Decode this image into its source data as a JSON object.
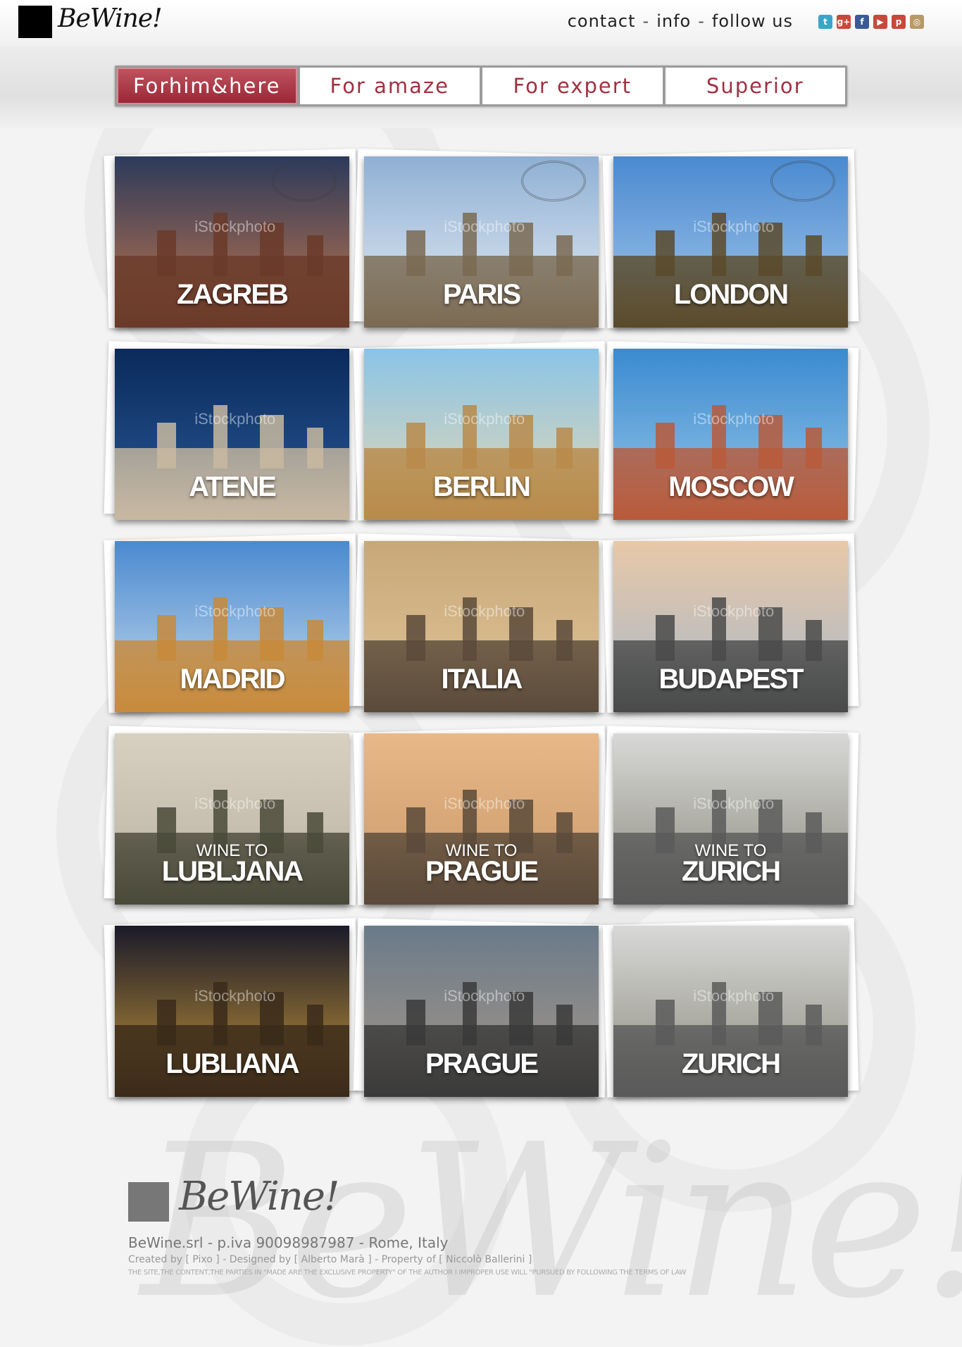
{
  "header": {
    "logo_text": "BeWine!",
    "nav": [
      {
        "label": "contact"
      },
      {
        "label": "info"
      },
      {
        "label": "follow us"
      }
    ],
    "separator": "-",
    "social": [
      {
        "name": "twitter-icon",
        "glyph": "t",
        "color": "#3aa5c8"
      },
      {
        "name": "google-plus-icon",
        "glyph": "g+",
        "color": "#c8493a"
      },
      {
        "name": "facebook-icon",
        "glyph": "f",
        "color": "#3a5a98"
      },
      {
        "name": "youtube-icon",
        "glyph": "▶",
        "color": "#c8493a"
      },
      {
        "name": "pinterest-icon",
        "glyph": "p",
        "color": "#c8493a"
      },
      {
        "name": "instagram-icon",
        "glyph": "◎",
        "color": "#b89a6a"
      }
    ]
  },
  "categories": [
    {
      "label": "Forhim&here",
      "active": true
    },
    {
      "label": "For amaze",
      "active": false
    },
    {
      "label": "For expert",
      "active": false
    },
    {
      "label": "Superior",
      "active": false
    }
  ],
  "cards": [
    {
      "city": "ZAGREB",
      "kicker": "",
      "sky": "#2c3a5c",
      "sky2": "#c6784a",
      "ground": "#6a3a2a",
      "stamp": true
    },
    {
      "city": "PARIS",
      "kicker": "",
      "sky": "#8fb0d4",
      "sky2": "#e8eef4",
      "ground": "#7a6a52",
      "stamp": true
    },
    {
      "city": "LONDON",
      "kicker": "",
      "sky": "#4a8ad0",
      "sky2": "#a6c8ea",
      "ground": "#5a4a2a",
      "stamp": true
    },
    {
      "city": "ATENE",
      "kicker": "",
      "sky": "#0a2a5a",
      "sky2": "#2a5a9a",
      "ground": "#c8b8a0",
      "stamp": false
    },
    {
      "city": "BERLIN",
      "kicker": "",
      "sky": "#8ac4e8",
      "sky2": "#e8d8b0",
      "ground": "#b88a4a",
      "stamp": false
    },
    {
      "city": "MOSCOW",
      "kicker": "",
      "sky": "#3a8ad0",
      "sky2": "#9ac8e8",
      "ground": "#b85a3a",
      "stamp": false
    },
    {
      "city": "MADRID",
      "kicker": "",
      "sky": "#4a8ad0",
      "sky2": "#c8dcec",
      "ground": "#c88a3a",
      "stamp": false
    },
    {
      "city": "ITALIA",
      "kicker": "",
      "sky": "#c8a878",
      "sky2": "#e0c49a",
      "ground": "#5a4a3a",
      "stamp": false
    },
    {
      "city": "BUDAPEST",
      "kicker": "",
      "sky": "#e8c8a8",
      "sky2": "#a8b8c8",
      "ground": "#4a4a4a",
      "stamp": false
    },
    {
      "city": "LUBLJANA",
      "kicker": "WINE TO",
      "sky": "#d8d0c0",
      "sky2": "#b8b0a0",
      "ground": "#4a4a3a",
      "stamp": false
    },
    {
      "city": "PRAGUE",
      "kicker": "WINE TO",
      "sky": "#e8b888",
      "sky2": "#c89868",
      "ground": "#5a4a3a",
      "stamp": false
    },
    {
      "city": "ZURICH",
      "kicker": "WINE TO",
      "sky": "#d8d8d8",
      "sky2": "#8a8a7a",
      "ground": "#5a5a5a",
      "stamp": false
    },
    {
      "city": "LUBLIANA",
      "kicker": "",
      "sky": "#1a1a2a",
      "sky2": "#c89838",
      "ground": "#3a2a1a",
      "stamp": false
    },
    {
      "city": "PRAGUE",
      "kicker": "",
      "sky": "#6a7a8a",
      "sky2": "#a89888",
      "ground": "#3a3a3a",
      "stamp": false
    },
    {
      "city": "ZURICH",
      "kicker": "",
      "sky": "#d8d8d8",
      "sky2": "#8a8a7a",
      "ground": "#5a5a5a",
      "stamp": false
    }
  ],
  "watermark": "iStockphoto",
  "footer": {
    "logo_text": "BeWine!",
    "company": "BeWine.srl - p.iva 90098987987 - Rome, Italy",
    "credits": "Created by [ Pixo ] - Designed by [ Alberto Marà ] - Property of [ Niccolò Ballerini ]",
    "legal": "THE SITE,THE CONTENT,THE PARTIES IN \"MADE ARE THE EXCLUSIVE PROPERTY\" OF THE AUTHOR I IMPROPER USE WILL \"PURSUED BY FOLLOWING THE TERMS OF LAW"
  },
  "colors": {
    "accent": "#a23040",
    "accent_active": "#9a2535"
  }
}
